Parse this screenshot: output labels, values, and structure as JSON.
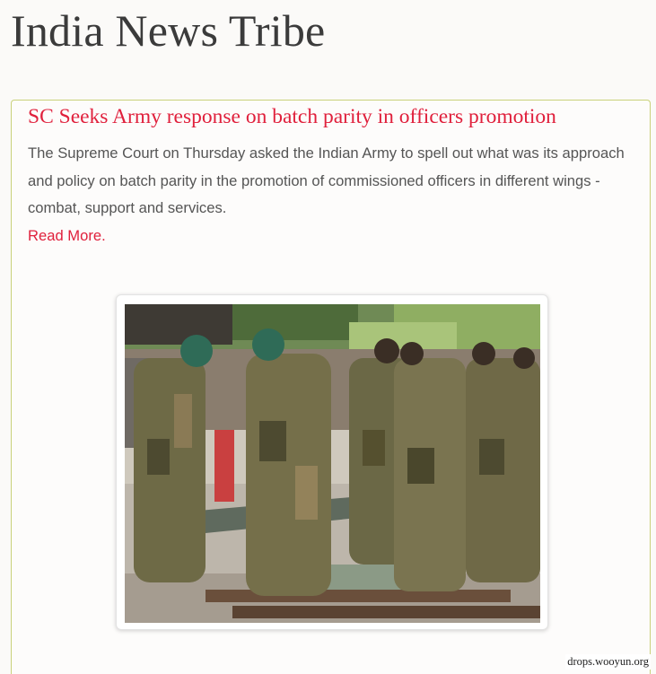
{
  "site": {
    "title": "India News Tribe"
  },
  "article": {
    "title": "SC Seeks Army response on batch parity in officers promotion",
    "summary": "The Supreme Court on Thursday asked the Indian Army to spell out what was its approach and policy on batch parity in the promotion of commissioned officers in different wings - combat, support and services.",
    "read_more": "Read More."
  },
  "photo": {
    "alt": "Soldiers carrying a steel beam"
  },
  "footer": {
    "watermark": "drops.wooyun.org"
  },
  "colors": {
    "accent": "#e0203c",
    "title_text": "#3b3b3b",
    "body_text": "#555555",
    "card_border": "#c9d17a",
    "background": "#fbfaf8"
  }
}
